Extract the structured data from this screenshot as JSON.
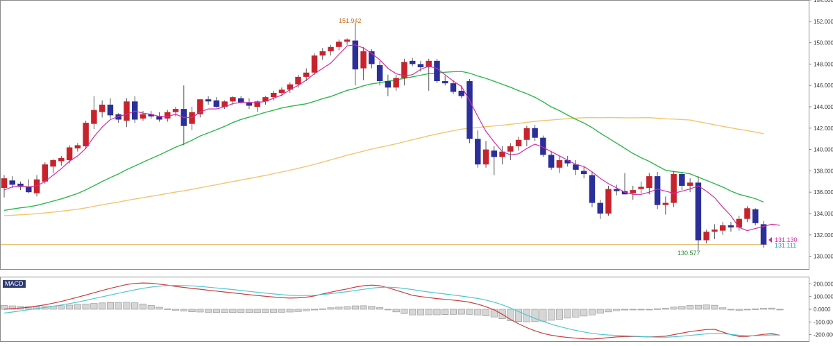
{
  "chart_data": [
    {
      "type": "candlestick",
      "ylim": [
        129,
        154
      ],
      "y_ticks": [
        "130.000",
        "132.000",
        "134.000",
        "136.000",
        "138.000",
        "140.000",
        "142.000",
        "144.000",
        "146.000",
        "148.000",
        "150.000",
        "152.000",
        "154.000"
      ],
      "y_values": [
        130,
        132,
        134,
        136,
        138,
        140,
        142,
        144,
        146,
        148,
        150,
        152,
        154
      ],
      "colors": {
        "up": "#c8232c",
        "down": "#2b2f9a",
        "ma_short": "#d42aa8",
        "ma_mid": "#2db84a",
        "ma_long": "#f2c46e",
        "hline": "#e8c07a"
      },
      "candles": [
        {
          "o": 136.4,
          "h": 137.6,
          "l": 135.5,
          "c": 137.3
        },
        {
          "o": 137.1,
          "h": 137.5,
          "l": 136.4,
          "c": 136.7
        },
        {
          "o": 136.8,
          "h": 137.0,
          "l": 136.2,
          "c": 136.5
        },
        {
          "o": 136.5,
          "h": 137.2,
          "l": 135.9,
          "c": 136.0
        },
        {
          "o": 135.9,
          "h": 137.6,
          "l": 135.6,
          "c": 137.2
        },
        {
          "o": 137.0,
          "h": 138.8,
          "l": 136.8,
          "c": 138.6
        },
        {
          "o": 138.4,
          "h": 139.1,
          "l": 137.8,
          "c": 139.0
        },
        {
          "o": 138.9,
          "h": 139.4,
          "l": 138.5,
          "c": 139.2
        },
        {
          "o": 139.0,
          "h": 140.4,
          "l": 138.7,
          "c": 140.2
        },
        {
          "o": 140.1,
          "h": 140.6,
          "l": 139.8,
          "c": 140.4
        },
        {
          "o": 140.3,
          "h": 142.7,
          "l": 140.1,
          "c": 142.5
        },
        {
          "o": 142.4,
          "h": 145.0,
          "l": 141.9,
          "c": 143.7
        },
        {
          "o": 143.5,
          "h": 144.6,
          "l": 143.0,
          "c": 144.2
        },
        {
          "o": 144.2,
          "h": 144.8,
          "l": 142.9,
          "c": 143.2
        },
        {
          "o": 143.3,
          "h": 143.4,
          "l": 142.5,
          "c": 142.8
        },
        {
          "o": 142.7,
          "h": 144.8,
          "l": 142.1,
          "c": 144.5
        },
        {
          "o": 144.5,
          "h": 145.0,
          "l": 142.5,
          "c": 142.8
        },
        {
          "o": 142.9,
          "h": 143.6,
          "l": 142.7,
          "c": 143.3
        },
        {
          "o": 143.3,
          "h": 143.6,
          "l": 142.9,
          "c": 143.1
        },
        {
          "o": 143.1,
          "h": 143.5,
          "l": 142.6,
          "c": 142.8
        },
        {
          "o": 142.9,
          "h": 143.7,
          "l": 142.6,
          "c": 143.5
        },
        {
          "o": 143.5,
          "h": 144.0,
          "l": 143.1,
          "c": 143.8
        },
        {
          "o": 143.8,
          "h": 146.0,
          "l": 140.4,
          "c": 142.2
        },
        {
          "o": 142.4,
          "h": 144.0,
          "l": 141.8,
          "c": 143.5
        },
        {
          "o": 143.3,
          "h": 144.7,
          "l": 143.0,
          "c": 144.7
        },
        {
          "o": 144.7,
          "h": 145.0,
          "l": 144.2,
          "c": 144.5
        },
        {
          "o": 144.6,
          "h": 144.9,
          "l": 143.9,
          "c": 144.0
        },
        {
          "o": 144.0,
          "h": 144.6,
          "l": 143.8,
          "c": 144.5
        },
        {
          "o": 144.5,
          "h": 145.0,
          "l": 144.2,
          "c": 144.9
        },
        {
          "o": 144.8,
          "h": 145.0,
          "l": 144.3,
          "c": 144.4
        },
        {
          "o": 144.4,
          "h": 144.8,
          "l": 143.8,
          "c": 144.1
        },
        {
          "o": 144.0,
          "h": 144.6,
          "l": 143.5,
          "c": 144.5
        },
        {
          "o": 144.5,
          "h": 145.0,
          "l": 144.2,
          "c": 144.9
        },
        {
          "o": 144.9,
          "h": 145.5,
          "l": 144.6,
          "c": 145.3
        },
        {
          "o": 145.3,
          "h": 145.8,
          "l": 145.0,
          "c": 145.6
        },
        {
          "o": 145.6,
          "h": 146.3,
          "l": 145.3,
          "c": 146.1
        },
        {
          "o": 146.1,
          "h": 147.0,
          "l": 145.8,
          "c": 146.8
        },
        {
          "o": 146.8,
          "h": 147.6,
          "l": 146.4,
          "c": 147.2
        },
        {
          "o": 147.2,
          "h": 149.0,
          "l": 147.0,
          "c": 148.8
        },
        {
          "o": 148.8,
          "h": 149.5,
          "l": 148.4,
          "c": 149.2
        },
        {
          "o": 149.2,
          "h": 149.8,
          "l": 148.8,
          "c": 149.6
        },
        {
          "o": 149.6,
          "h": 150.3,
          "l": 149.3,
          "c": 150.1
        },
        {
          "o": 150.1,
          "h": 150.4,
          "l": 149.8,
          "c": 150.3
        },
        {
          "o": 150.2,
          "h": 151.9,
          "l": 146.0,
          "c": 147.5
        },
        {
          "o": 147.6,
          "h": 149.6,
          "l": 146.5,
          "c": 149.2
        },
        {
          "o": 149.2,
          "h": 149.4,
          "l": 147.6,
          "c": 148.0
        },
        {
          "o": 147.9,
          "h": 148.3,
          "l": 146.0,
          "c": 146.4
        },
        {
          "o": 146.4,
          "h": 147.0,
          "l": 145.0,
          "c": 145.8
        },
        {
          "o": 145.8,
          "h": 147.0,
          "l": 145.5,
          "c": 146.7
        },
        {
          "o": 146.7,
          "h": 148.5,
          "l": 146.0,
          "c": 148.2
        },
        {
          "o": 148.3,
          "h": 148.6,
          "l": 147.8,
          "c": 148.0
        },
        {
          "o": 148.0,
          "h": 148.3,
          "l": 147.3,
          "c": 147.7
        },
        {
          "o": 147.7,
          "h": 148.5,
          "l": 145.5,
          "c": 148.3
        },
        {
          "o": 148.3,
          "h": 148.5,
          "l": 146.2,
          "c": 146.4
        },
        {
          "o": 146.4,
          "h": 146.9,
          "l": 146.0,
          "c": 146.2
        },
        {
          "o": 146.2,
          "h": 146.5,
          "l": 145.2,
          "c": 145.4
        },
        {
          "o": 145.5,
          "h": 146.0,
          "l": 144.8,
          "c": 145.0
        },
        {
          "o": 146.4,
          "h": 146.6,
          "l": 140.6,
          "c": 141.0
        },
        {
          "o": 141.0,
          "h": 141.8,
          "l": 138.3,
          "c": 138.6
        },
        {
          "o": 138.6,
          "h": 140.8,
          "l": 138.3,
          "c": 140.0
        },
        {
          "o": 139.9,
          "h": 140.3,
          "l": 137.6,
          "c": 139.3
        },
        {
          "o": 139.3,
          "h": 140.3,
          "l": 138.6,
          "c": 139.8
        },
        {
          "o": 139.8,
          "h": 140.6,
          "l": 139.0,
          "c": 140.3
        },
        {
          "o": 140.3,
          "h": 141.2,
          "l": 139.9,
          "c": 140.9
        },
        {
          "o": 140.9,
          "h": 142.2,
          "l": 140.3,
          "c": 142.0
        },
        {
          "o": 142.0,
          "h": 142.3,
          "l": 140.8,
          "c": 141.1
        },
        {
          "o": 141.1,
          "h": 141.3,
          "l": 139.3,
          "c": 139.5
        },
        {
          "o": 139.5,
          "h": 139.8,
          "l": 138.1,
          "c": 138.3
        },
        {
          "o": 138.3,
          "h": 139.4,
          "l": 137.8,
          "c": 139.0
        },
        {
          "o": 139.0,
          "h": 139.4,
          "l": 138.4,
          "c": 138.7
        },
        {
          "o": 138.6,
          "h": 139.0,
          "l": 137.6,
          "c": 138.1
        },
        {
          "o": 138.0,
          "h": 138.4,
          "l": 137.3,
          "c": 137.7
        },
        {
          "o": 137.6,
          "h": 137.9,
          "l": 134.6,
          "c": 135.0
        },
        {
          "o": 135.0,
          "h": 135.3,
          "l": 133.5,
          "c": 134.0
        },
        {
          "o": 134.0,
          "h": 136.6,
          "l": 133.8,
          "c": 136.3
        },
        {
          "o": 136.3,
          "h": 136.7,
          "l": 135.7,
          "c": 136.1
        },
        {
          "o": 136.1,
          "h": 137.8,
          "l": 135.8,
          "c": 135.8
        },
        {
          "o": 135.9,
          "h": 136.6,
          "l": 135.3,
          "c": 136.2
        },
        {
          "o": 136.3,
          "h": 137.0,
          "l": 135.9,
          "c": 136.5
        },
        {
          "o": 136.4,
          "h": 137.8,
          "l": 135.8,
          "c": 137.5
        },
        {
          "o": 137.5,
          "h": 137.9,
          "l": 134.4,
          "c": 134.8
        },
        {
          "o": 134.8,
          "h": 135.6,
          "l": 133.9,
          "c": 135.0
        },
        {
          "o": 135.0,
          "h": 138.0,
          "l": 134.6,
          "c": 137.7
        },
        {
          "o": 137.7,
          "h": 137.9,
          "l": 136.2,
          "c": 136.6
        },
        {
          "o": 136.6,
          "h": 137.3,
          "l": 136.0,
          "c": 136.9
        },
        {
          "o": 136.9,
          "h": 137.5,
          "l": 130.6,
          "c": 131.5
        },
        {
          "o": 131.5,
          "h": 132.5,
          "l": 131.2,
          "c": 132.3
        },
        {
          "o": 132.3,
          "h": 133.0,
          "l": 131.6,
          "c": 132.5
        },
        {
          "o": 132.4,
          "h": 133.2,
          "l": 132.0,
          "c": 132.9
        },
        {
          "o": 132.9,
          "h": 133.2,
          "l": 132.3,
          "c": 132.7
        },
        {
          "o": 132.7,
          "h": 133.8,
          "l": 132.4,
          "c": 133.5
        },
        {
          "o": 133.5,
          "h": 134.7,
          "l": 133.2,
          "c": 134.5
        },
        {
          "o": 134.4,
          "h": 134.5,
          "l": 132.9,
          "c": 133.1
        },
        {
          "o": 133.0,
          "h": 133.3,
          "l": 130.8,
          "c": 131.1
        }
      ],
      "ma_short": [
        136.2,
        136.5,
        136.6,
        136.5,
        136.6,
        137.0,
        137.6,
        138.2,
        138.9,
        139.4,
        140.1,
        141.2,
        142.1,
        142.8,
        143.1,
        143.3,
        143.6,
        143.4,
        143.3,
        143.1,
        143.1,
        143.3,
        143.0,
        143.0,
        143.5,
        143.8,
        143.8,
        144.0,
        144.3,
        144.4,
        144.4,
        144.4,
        144.5,
        144.8,
        145.1,
        145.6,
        146.0,
        146.5,
        147.1,
        147.6,
        148.1,
        148.9,
        149.7,
        149.8,
        149.5,
        149.0,
        148.4,
        147.6,
        147.1,
        146.9,
        147.0,
        147.5,
        147.8,
        147.6,
        147.0,
        146.4,
        145.9,
        144.6,
        143.1,
        141.7,
        140.7,
        139.8,
        139.5,
        139.6,
        140.1,
        140.5,
        140.2,
        139.8,
        139.4,
        139.0,
        138.6,
        138.4,
        137.9,
        137.3,
        136.8,
        136.4,
        136.0,
        135.8,
        135.8,
        136.0,
        136.3,
        136.1,
        135.9,
        136.1,
        136.3,
        136.6,
        136.1,
        135.5,
        134.6,
        133.8,
        132.7,
        132.4,
        132.6,
        132.8,
        133.0,
        132.9
      ]
    },
    {
      "type": "line",
      "y_ticks": [
        "200.0000",
        "100.0000",
        "0.0000",
        "-100.0000",
        "-200.0000"
      ],
      "y_values": [
        200,
        100,
        0,
        -100,
        -200
      ],
      "ylim": [
        -235,
        235
      ],
      "series": [
        {
          "role": "macd",
          "color": "#c83c3c",
          "values": [
            0,
            5,
            10,
            16,
            25,
            35,
            48,
            62,
            78,
            95,
            112,
            130,
            148,
            165,
            180,
            195,
            204,
            207,
            205,
            198,
            190,
            180,
            172,
            164,
            158,
            150,
            143,
            136,
            129,
            122,
            115,
            108,
            102,
            96,
            91,
            88,
            90,
            95,
            105,
            120,
            135,
            148,
            160,
            175,
            185,
            190,
            185,
            170,
            150,
            130,
            110,
            100,
            92,
            84,
            78,
            72,
            65,
            55,
            40,
            20,
            -5,
            -40,
            -80,
            -115,
            -145,
            -170,
            -190,
            -205,
            -215,
            -222,
            -228,
            -233,
            -235,
            -230,
            -224,
            -218,
            -215,
            -214,
            -216,
            -218,
            -216,
            -212,
            -200,
            -188,
            -176,
            -168,
            -160,
            -158,
            -180,
            -200,
            -215,
            -214,
            -206,
            -198,
            -192,
            -205
          ]
        },
        {
          "role": "signal",
          "color": "#4ec6d2",
          "values": [
            -30,
            -22,
            -13,
            -4,
            5,
            14,
            24,
            34,
            45,
            57,
            70,
            84,
            98,
            112,
            126,
            140,
            153,
            165,
            175,
            182,
            187,
            188,
            187,
            184,
            180,
            174,
            168,
            162,
            155,
            148,
            141,
            134,
            127,
            121,
            115,
            110,
            108,
            108,
            110,
            116,
            123,
            131,
            139,
            148,
            157,
            166,
            172,
            174,
            171,
            164,
            155,
            145,
            136,
            128,
            120,
            112,
            104,
            95,
            85,
            72,
            56,
            35,
            10,
            -18,
            -46,
            -72,
            -96,
            -118,
            -136,
            -152,
            -166,
            -179,
            -190,
            -198,
            -203,
            -206,
            -209,
            -212,
            -215,
            -218,
            -220,
            -220,
            -217,
            -212,
            -206,
            -200,
            -194,
            -190,
            -192,
            -198,
            -205,
            -209,
            -209,
            -206,
            -202,
            -204
          ]
        }
      ]
    }
  ],
  "annotations": {
    "high_label": "151.942",
    "low_label": "130.577",
    "last_ma_label": "131.130",
    "last_price_label": "131.111"
  },
  "indicator_badge": "MACD"
}
